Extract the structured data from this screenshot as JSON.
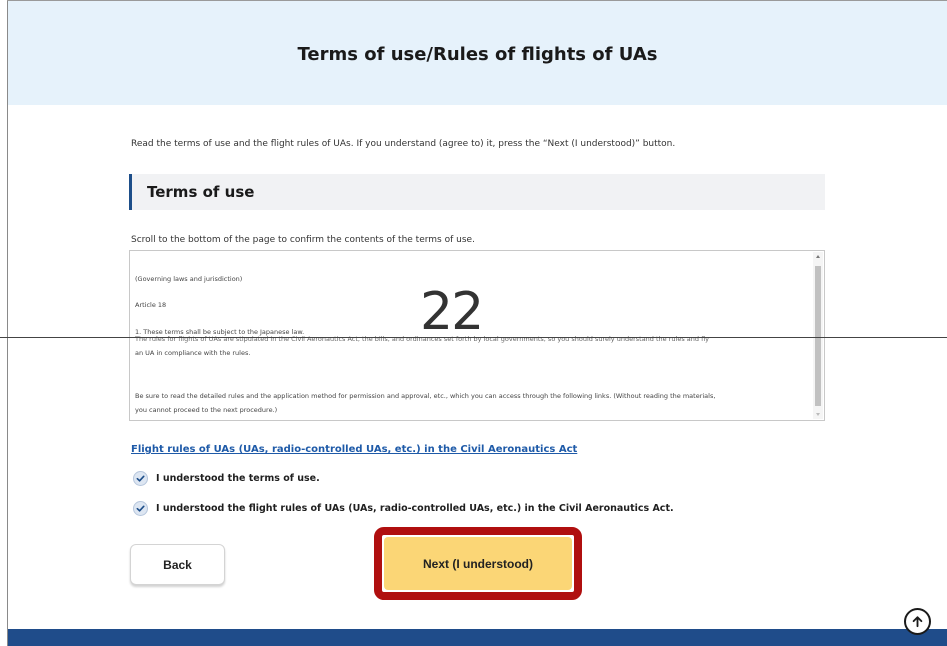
{
  "header": {
    "title": "Terms of use/Rules of flights of UAs"
  },
  "intro_text": "Read the terms of use and the flight rules of UAs. If you understand (agree to) it, press the “Next (I understood)” button.",
  "terms_section": {
    "heading": "Terms of use",
    "scroll_note": "Scroll to the bottom of the page to confirm the contents of the terms of use.",
    "box_lines": [
      "(Governing laws and jurisdiction)",
      "Article 18",
      "1. These terms shall be subject to the Japanese law.",
      "The rules for flights of UAs are stipulated in the Civil Aeronautics Act, the bills, and ordinances set forth by local governments, so you should surely understand the rules and fly",
      "an UA in compliance with the rules.",
      "Be sure to read the detailed rules and the application method for permission and approval, etc., which you can access through the following links. (Without reading the materials,",
      "you cannot proceed to the next procedure.)"
    ],
    "scroll_position": 0.92
  },
  "overlay": {
    "step_number": "22"
  },
  "rules_link": "Flight rules of UAs (UAs, radio-controlled UAs, etc.) in the Civil Aeronautics Act",
  "checkboxes": [
    {
      "label": "I understood the terms of use.",
      "checked": true
    },
    {
      "label": "I understood the flight rules of UAs (UAs, radio-controlled UAs, etc.) in the Civil Aeronautics Act.",
      "checked": true
    }
  ],
  "buttons": {
    "back": "Back",
    "next": "Next (I understood)"
  },
  "colors": {
    "header_bg": "#e6f2fb",
    "accent_bar": "#1d4e89",
    "next_button": "#fbd676",
    "highlight": "#b00f0f",
    "link": "#1e5aa8",
    "footer": "#1f4c8a"
  },
  "icons": {
    "check": "check-icon",
    "page_top": "arrow-up-circle-icon"
  }
}
